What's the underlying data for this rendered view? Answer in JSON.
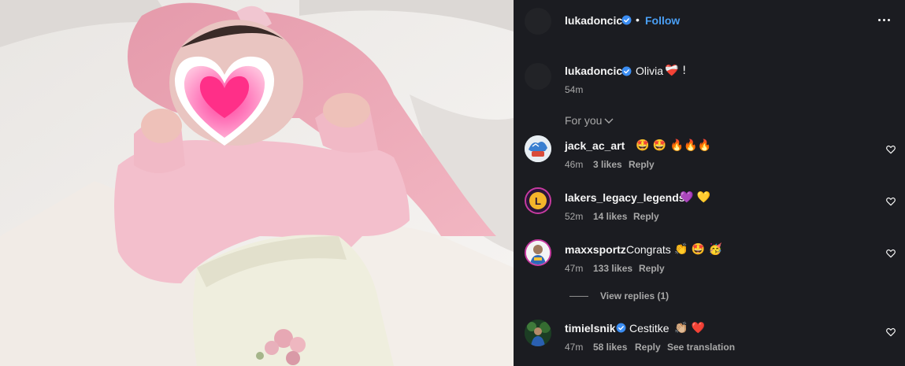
{
  "post": {
    "username": "lukadoncic",
    "follow_label": "Follow",
    "dot": "•"
  },
  "caption": {
    "username": "lukadoncic",
    "text": "Olivia",
    "emoji": "❤️‍🩹 !",
    "time": "54m"
  },
  "filter": {
    "label": "For you"
  },
  "comments": [
    {
      "username": "jack_ac_art",
      "text": "",
      "emoji": "🤩 🤩 🔥🔥🔥",
      "time": "46m",
      "likes": "3 likes",
      "reply": "Reply",
      "verified": false
    },
    {
      "username": "lakers_legacy_legends",
      "text": "",
      "emoji": "💜 💛",
      "time": "52m",
      "likes": "14 likes",
      "reply": "Reply",
      "verified": false
    },
    {
      "username": "maxxsportz",
      "text": "Congrats",
      "emoji": "👏 🤩 🥳",
      "time": "47m",
      "likes": "133 likes",
      "reply": "Reply",
      "verified": false,
      "view_replies": "View replies (1)"
    },
    {
      "username": "timielsnik",
      "text": "Cestitke",
      "emoji": "👏🏼 ❤️",
      "time": "47m",
      "likes": "58 likes",
      "reply": "Reply",
      "see_translation": "See translation",
      "verified": true
    }
  ],
  "colors": {
    "panel_bg": "#1b1c21",
    "accent": "#4a9ff5",
    "secondary_text": "#a8a8a8",
    "verified": "#3b8df2"
  },
  "icons": {
    "verified": "verified-badge-icon",
    "more": "more-options-icon",
    "chevron": "chevron-down-icon",
    "like": "heart-outline-icon"
  }
}
